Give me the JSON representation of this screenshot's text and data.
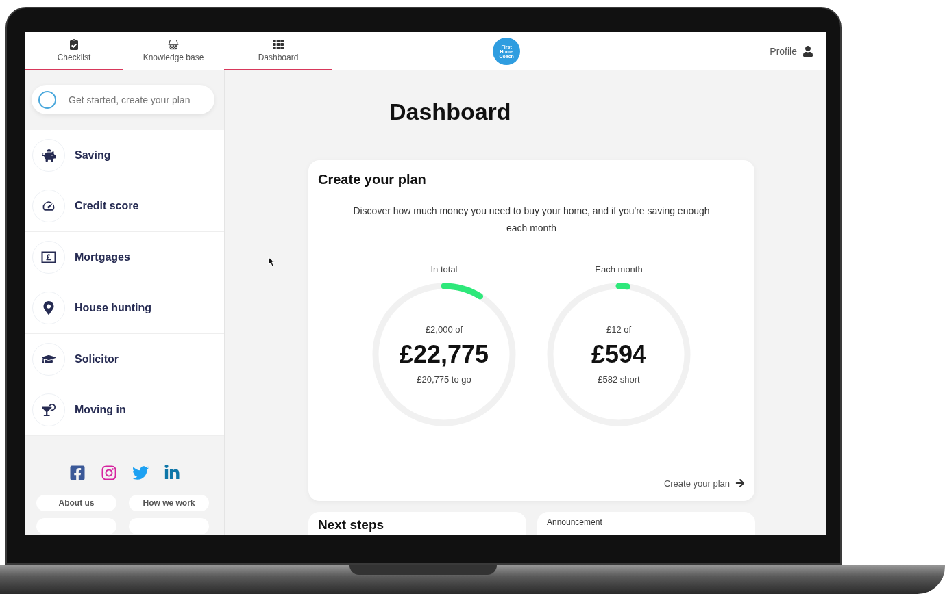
{
  "nav": {
    "tabs": [
      {
        "label": "Checklist",
        "selected": true
      },
      {
        "label": "Knowledge base",
        "selected": false
      },
      {
        "label": "Dashboard",
        "selected": true
      }
    ],
    "logo": "First Home Coach",
    "profile": "Profile"
  },
  "sidebar": {
    "start": "Get started, create your plan",
    "items": [
      {
        "label": "Saving"
      },
      {
        "label": "Credit score"
      },
      {
        "label": "Mortgages"
      },
      {
        "label": "House hunting"
      },
      {
        "label": "Solicitor"
      },
      {
        "label": "Moving in"
      }
    ],
    "links": [
      "About us",
      "How we work"
    ]
  },
  "main": {
    "title": "Dashboard",
    "plan_card": {
      "title": "Create your plan",
      "description": "Discover how much money you need to buy your home, and if you're saving enough each month",
      "rings": [
        {
          "caption": "In total",
          "of": "£2,000 of",
          "amount": "£22,775",
          "note": "£20,775 to go",
          "level": 0.088
        },
        {
          "caption": "Each month",
          "of": "£12 of",
          "amount": "£594",
          "note": "£582 short",
          "level": 0.02
        }
      ],
      "link": "Create your plan"
    },
    "cards": [
      {
        "kind": "heading",
        "text": "Next steps"
      },
      {
        "kind": "label",
        "text": "Announcement"
      }
    ]
  }
}
